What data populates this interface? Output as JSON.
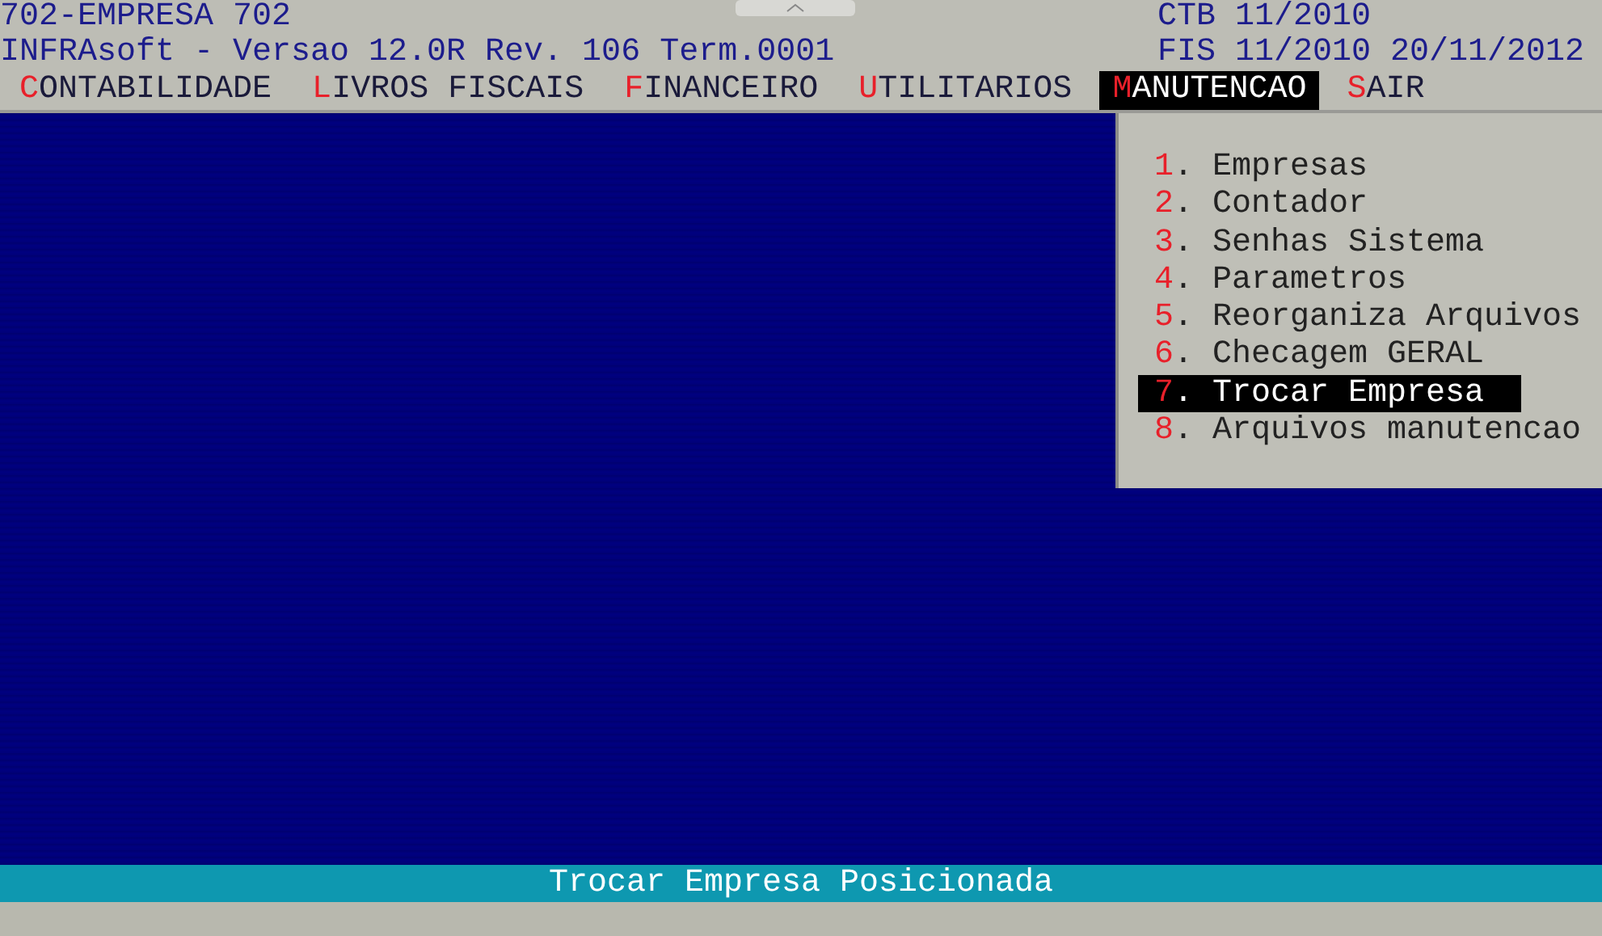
{
  "header": {
    "company": "702-EMPRESA 702",
    "version": "INFRAsoft - Versao 12.0R Rev. 106 Term.0001",
    "period_ctb": "CTB 11/2010",
    "period_fis": "FIS 11/2010 20/11/2012"
  },
  "menu_bar": [
    {
      "label": "CONTABILIDADE",
      "selected": false
    },
    {
      "label": "LIVROS FISCAIS",
      "selected": false
    },
    {
      "label": "FINANCEIRO",
      "selected": false
    },
    {
      "label": "UTILITARIOS",
      "selected": false
    },
    {
      "label": "MANUTENCAO",
      "selected": true
    },
    {
      "label": "SAIR",
      "selected": false
    }
  ],
  "dropdown": [
    {
      "label": "1. Empresas",
      "selected": false
    },
    {
      "label": "2. Contador",
      "selected": false
    },
    {
      "label": "3. Senhas Sistema",
      "selected": false
    },
    {
      "label": "4. Parametros",
      "selected": false
    },
    {
      "label": "5. Reorganiza Arquivos",
      "selected": false
    },
    {
      "label": "6. Checagem GERAL",
      "selected": false
    },
    {
      "label": "7. Trocar Empresa",
      "selected": true
    },
    {
      "label": "8. Arquivos manutencao",
      "selected": false
    }
  ],
  "status_bar": "Trocar Empresa Posicionada"
}
